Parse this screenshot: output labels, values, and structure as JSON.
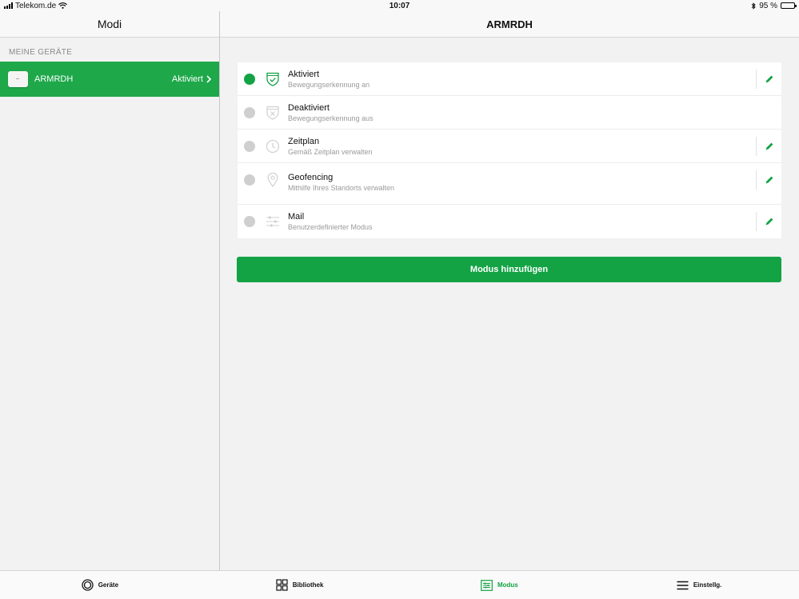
{
  "status_bar": {
    "carrier": "Telekom.de",
    "time": "10:07",
    "battery": "95 %",
    "battery_level": 0.95
  },
  "left_pane": {
    "title": "Modi",
    "section_label": "MEINE GERÄTE",
    "device": {
      "name": "ARMRDH",
      "status": "Aktiviert"
    }
  },
  "right_pane": {
    "title": "ARMRDH",
    "modes": [
      {
        "title": "Aktiviert",
        "subtitle": "Bewegungserkennung an",
        "active": true,
        "icon": "shield-check-icon"
      },
      {
        "title": "Deaktiviert",
        "subtitle": "Bewegungserkennung aus",
        "active": false,
        "icon": "shield-x-icon"
      },
      {
        "title": "Zeitplan",
        "subtitle": "Gemäß Zeitplan verwalten",
        "active": false,
        "icon": "clock-icon"
      },
      {
        "title": "Geofencing",
        "subtitle": "Mithilfe Ihres Standorts verwalten",
        "active": false,
        "icon": "location-pin-icon"
      },
      {
        "title": "Mail",
        "subtitle": "Benutzerdefinierter Modus",
        "active": false,
        "icon": "sliders-icon"
      }
    ],
    "add_button": "Modus hinzufügen"
  },
  "tab_bar": {
    "tabs": [
      {
        "label": "Geräte",
        "icon": "camera-ring-icon"
      },
      {
        "label": "Bibliothek",
        "icon": "grid-icon"
      },
      {
        "label": "Modus",
        "icon": "sliders-box-icon",
        "active": true
      },
      {
        "label": "Einstellg.",
        "icon": "menu-icon"
      }
    ]
  },
  "colors": {
    "accent": "#13a344",
    "selected_row": "#1ea84a",
    "inactive_radio": "#cfcfcf"
  }
}
